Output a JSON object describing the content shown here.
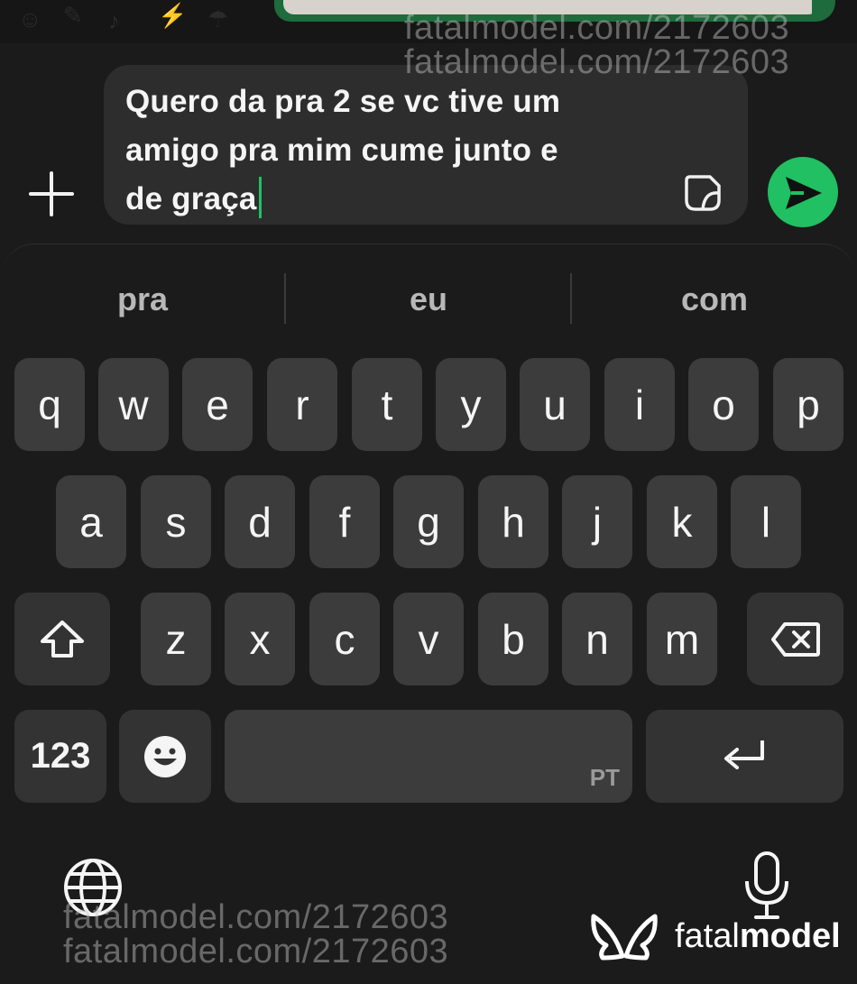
{
  "chat": {
    "message_draft": "Quero da pra 2 se vc tive um\namigo pra mim cume junto e\nde graça"
  },
  "suggestions": [
    "pra",
    "eu",
    "com"
  ],
  "keyboard": {
    "row1": [
      "q",
      "w",
      "e",
      "r",
      "t",
      "y",
      "u",
      "i",
      "o",
      "p"
    ],
    "row2": [
      "a",
      "s",
      "d",
      "f",
      "g",
      "h",
      "j",
      "k",
      "l"
    ],
    "row3": [
      "z",
      "x",
      "c",
      "v",
      "b",
      "n",
      "m"
    ],
    "numbers_label": "123",
    "language_label": "PT"
  },
  "watermark": {
    "text": "fatalmodel.com/2172603",
    "brand_light": "fatal",
    "brand_bold": "model"
  },
  "colors": {
    "accent": "#21c063",
    "key": "#3c3c3c",
    "background": "#1b1b1b"
  }
}
